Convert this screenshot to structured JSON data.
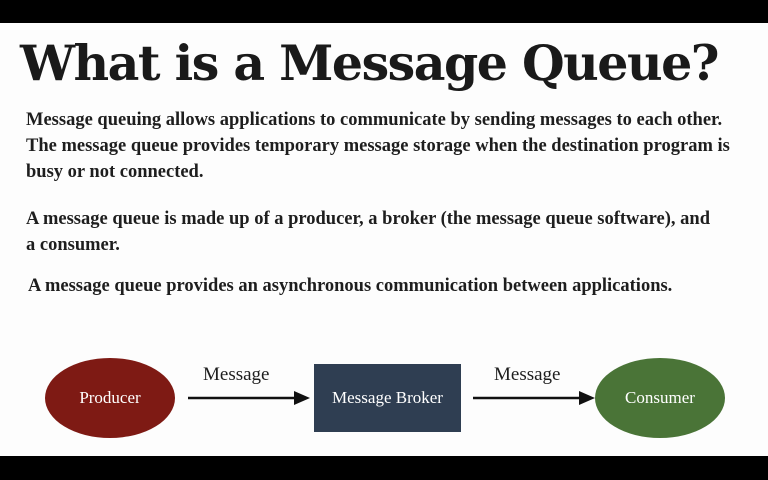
{
  "slide": {
    "title": "What is a Message Queue?",
    "paragraphs": [
      "Message queuing allows applications to communicate by sending messages to each other. The message queue provides temporary message storage when the destination program is busy or not connected.",
      "A message queue is made up of a producer, a broker (the message queue software), and a consumer.",
      "A message queue provides an asynchronous communication between applications."
    ]
  },
  "diagram": {
    "nodes": {
      "producer": {
        "label": "Producer",
        "color": "#7e1a14"
      },
      "broker": {
        "label": "Message Broker",
        "color": "#2f3e52"
      },
      "consumer": {
        "label": "Consumer",
        "color": "#4a7437"
      }
    },
    "edges": [
      {
        "label": "Message",
        "from": "Producer",
        "to": "Message Broker"
      },
      {
        "label": "Message",
        "from": "Message Broker",
        "to": "Consumer"
      }
    ]
  }
}
